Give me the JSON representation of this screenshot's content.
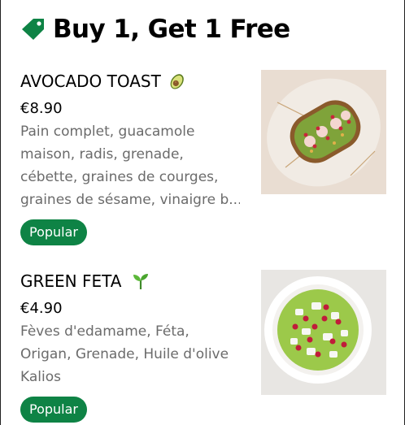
{
  "section": {
    "title": "Buy 1, Get 1 Free",
    "icon": "tag-icon",
    "accent": "#0e8345"
  },
  "items": [
    {
      "name": "AVOCADO TOAST",
      "emoji": "avocado-icon",
      "price": "€8.90",
      "description_lines": [
        "Pain complet, guacamole",
        "maison, radis, grenade,",
        "cébette, graines de courges,",
        "graines de sésame, vinaigre b..."
      ],
      "badge": "Popular",
      "image": "avocado-toast-photo"
    },
    {
      "name": "GREEN FETA",
      "emoji": "seedling-icon",
      "price": "€4.90",
      "description_lines": [
        "Fèves d'edamame, Féta,",
        "Origan,  Grenade, Huile d'olive",
        "Kalios"
      ],
      "badge": "Popular",
      "image": "green-feta-photo"
    }
  ]
}
